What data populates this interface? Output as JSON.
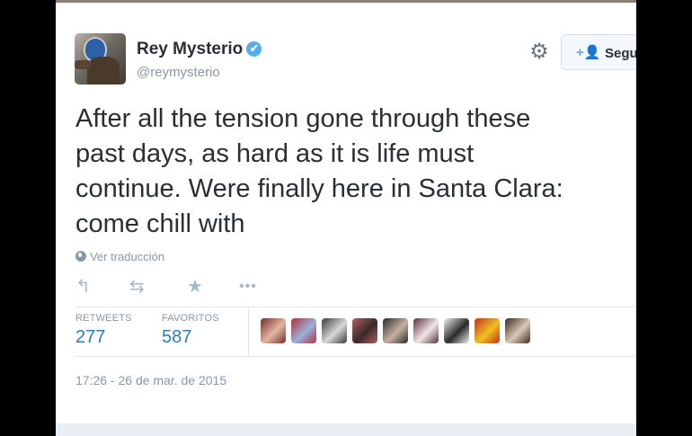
{
  "user": {
    "name": "Rey Mysterio",
    "handle": "@reymysterio",
    "verified_icon": "✔"
  },
  "follow_button": {
    "icon": "+👤",
    "label": "Segu"
  },
  "tweet": {
    "lines": [
      "After all the tension gone through these",
      "past days, as hard as it is life must",
      "continue. Were finally here in Santa Clara:",
      "come chill with"
    ],
    "translate_label": "Ver traducción"
  },
  "actions": {
    "reply_icon": "reply-icon",
    "retweet_icon": "retweet-icon",
    "favorite_icon": "star-icon",
    "more_icon": "more-icon"
  },
  "stats": {
    "retweets_label": "RETWEETS",
    "retweets_value": "277",
    "favorites_label": "FAVORITOS",
    "favorites_value": "587"
  },
  "favoriters": [
    {
      "color_a": "#7a2a2a",
      "color_b": "#e2b7a0"
    },
    {
      "color_a": "#b03040",
      "color_b": "#9ab0d8"
    },
    {
      "color_a": "#3a3a3a",
      "color_b": "#d8d8d8"
    },
    {
      "color_a": "#b06060",
      "color_b": "#3a2a2a"
    },
    {
      "color_a": "#2a2a2a",
      "color_b": "#c8b0a0"
    },
    {
      "color_a": "#5a3040",
      "color_b": "#efe6e6"
    },
    {
      "color_a": "#f0f0f0",
      "color_b": "#2a2a2a"
    },
    {
      "color_a": "#c03020",
      "color_b": "#f0c020"
    },
    {
      "color_a": "#3a2a20",
      "color_b": "#d8c8b8"
    }
  ],
  "timestamp": "17:26 - 26 de mar. de 2015"
}
